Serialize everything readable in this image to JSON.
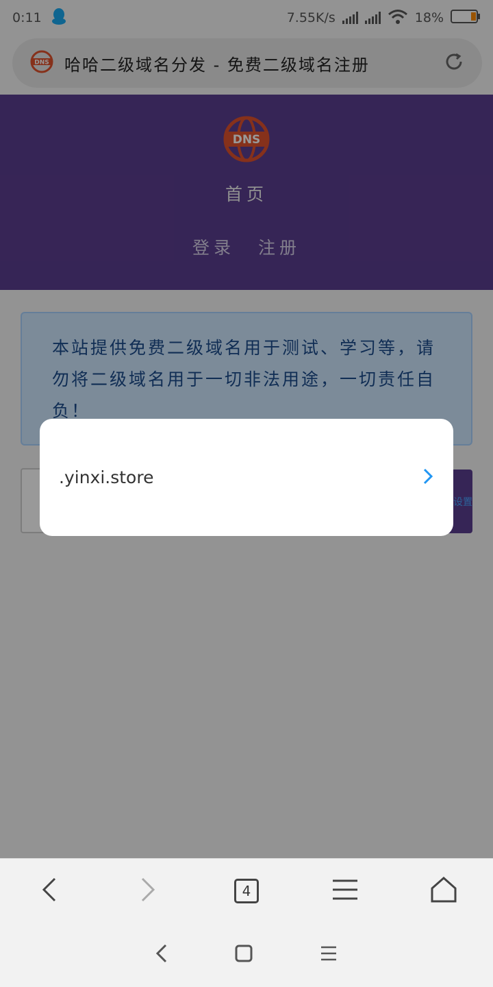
{
  "status_bar": {
    "time": "0:11",
    "network_speed": "7.55K/s",
    "battery_percent": "18%",
    "qq_icon": "qq-penguin-icon",
    "wifi_icon": "wifi-icon"
  },
  "browser": {
    "page_title": "哈哈二级域名分发 - 免费二级域名注册",
    "site_icon": "dns-globe-icon",
    "reload_icon": "reload-icon"
  },
  "header": {
    "logo_text": "DNS",
    "nav_home": "首页",
    "nav_login": "登录",
    "nav_register": "注册",
    "background_color": "#5b3e90"
  },
  "notice": {
    "text": "本站提供免费二级域名用于测试、学习等，请勿将二级域名用于一切非法用途，一切责任自负！"
  },
  "form": {
    "query_button_label": "流量设置"
  },
  "dialog": {
    "option_label": ".yinxi.store",
    "accent_color": "#2196f3"
  },
  "toolbar": {
    "tabs_count": "4"
  }
}
